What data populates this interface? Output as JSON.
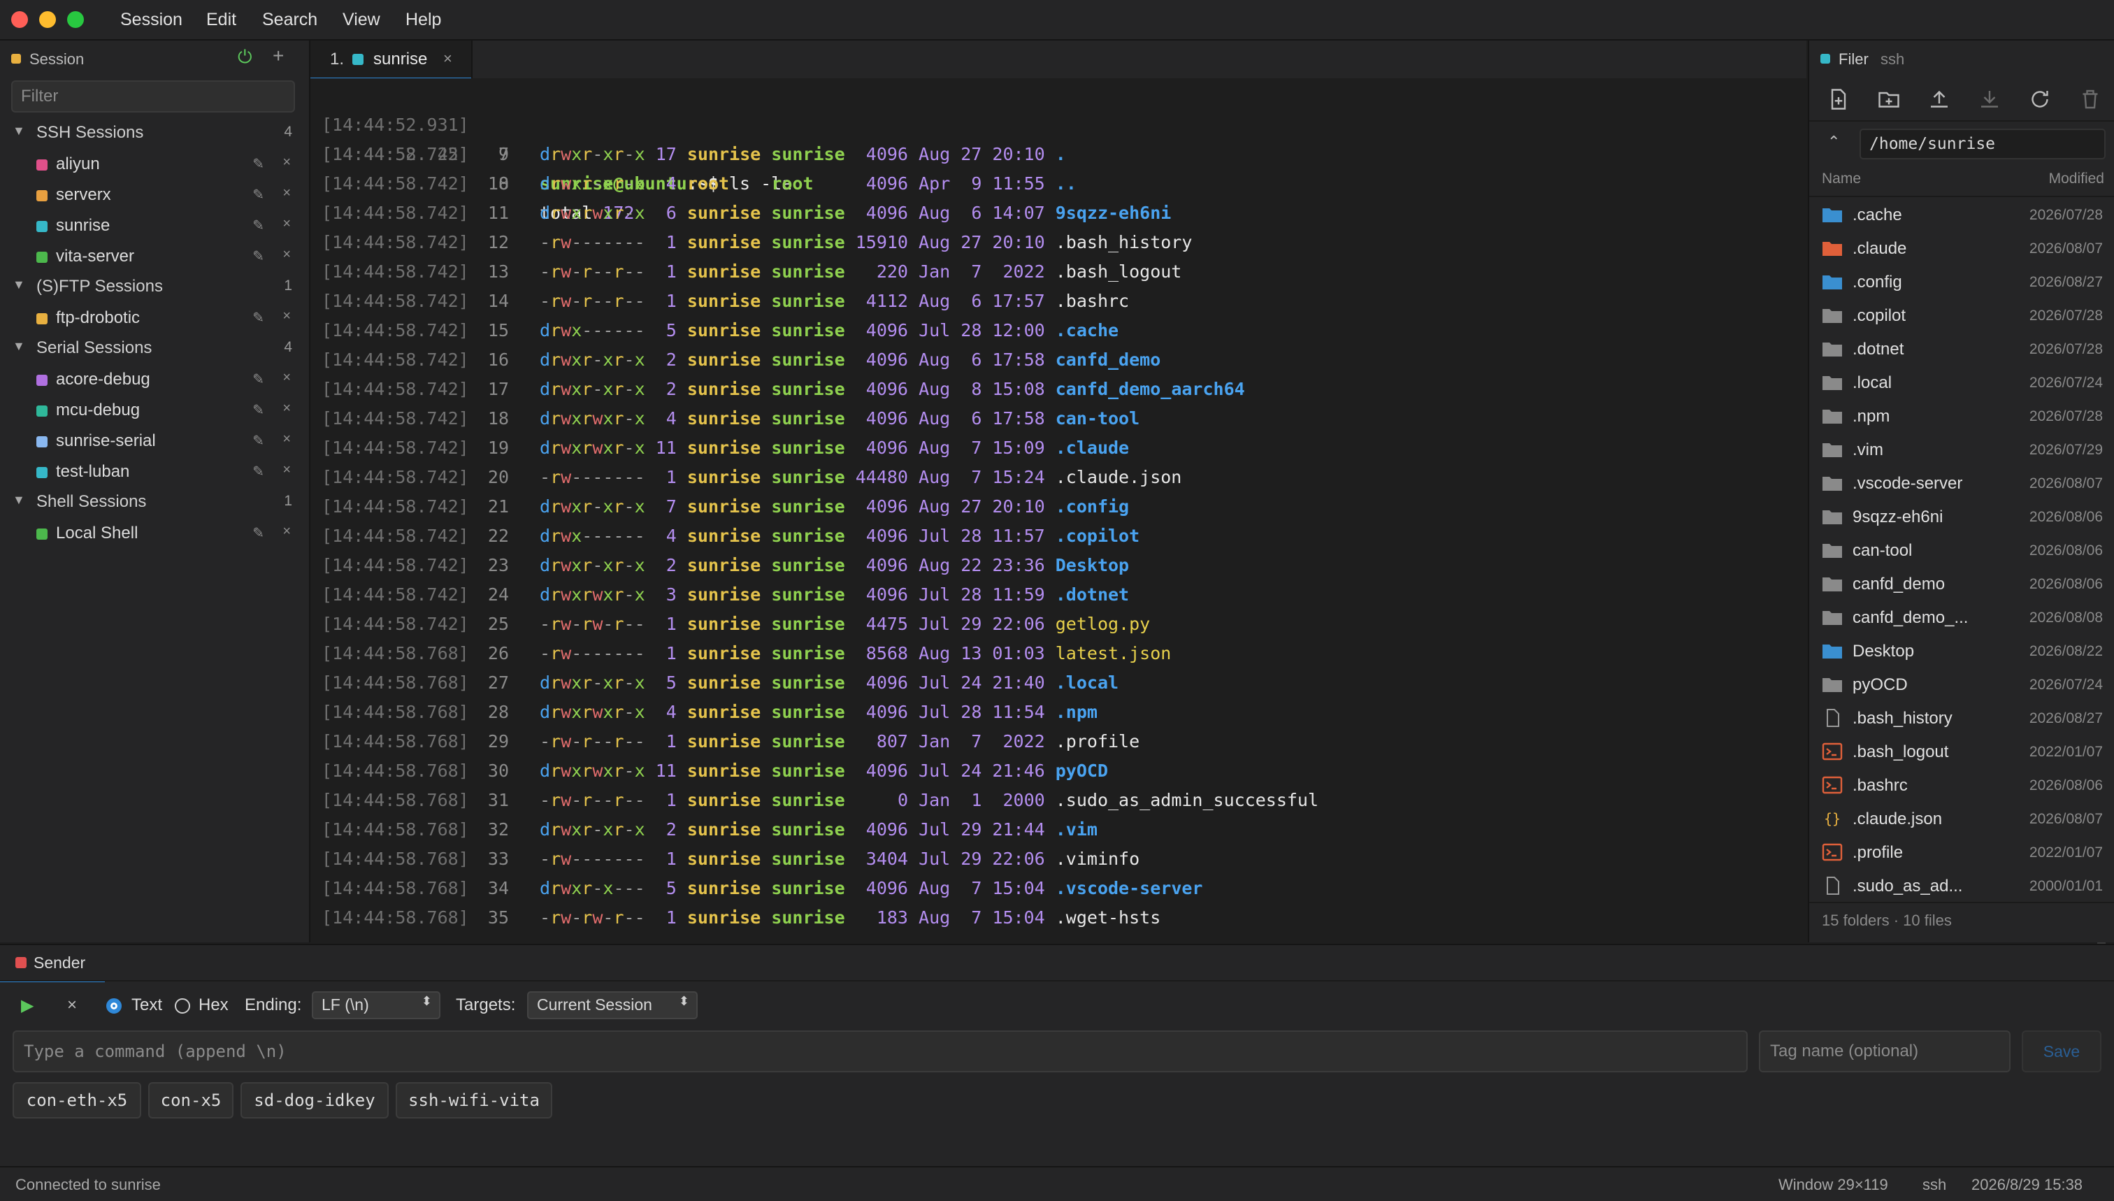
{
  "menu": [
    "Session",
    "Edit",
    "Search",
    "View",
    "Help"
  ],
  "left_panel": {
    "title": "Session",
    "filter_placeholder": "Filter",
    "groups": [
      {
        "name": "SSH Sessions",
        "count": "4",
        "items": [
          {
            "name": "aliyun",
            "color": "#e0508a"
          },
          {
            "name": "serverx",
            "color": "#e8a040"
          },
          {
            "name": "sunrise",
            "color": "#36b8c8"
          },
          {
            "name": "vita-server",
            "color": "#4cb84c"
          }
        ]
      },
      {
        "name": "(S)FTP Sessions",
        "count": "1",
        "items": [
          {
            "name": "ftp-drobotic",
            "color": "#e8b040"
          }
        ]
      },
      {
        "name": "Serial Sessions",
        "count": "4",
        "items": [
          {
            "name": "acore-debug",
            "color": "#b070e0"
          },
          {
            "name": "mcu-debug",
            "color": "#2fb89a"
          },
          {
            "name": "sunrise-serial",
            "color": "#8ab8f0"
          },
          {
            "name": "test-luban",
            "color": "#36b8c8"
          }
        ]
      },
      {
        "name": "Shell Sessions",
        "count": "1",
        "items": [
          {
            "name": "Local Shell",
            "color": "#4cb84c"
          }
        ]
      }
    ]
  },
  "tab": {
    "number": "1.",
    "label": "sunrise",
    "close": "×",
    "color": "#36b8c8"
  },
  "terminal": {
    "prompt_user": "sunrise@ubuntu",
    "prompt_path": ":~$",
    "command": " ls -la",
    "first_ts": "[14:44:52.931]",
    "first_ln": "7",
    "total_ts": "[14:44:52.725]",
    "total_ln": "8",
    "total_label": "total",
    "total_value": "172",
    "rows": [
      {
        "ts": "[14:44:58.742]",
        "ln": "9",
        "perm": "drwxr-xr-x",
        "links": "17",
        "owner": "sunrise",
        "group": "sunrise",
        "size": "4096",
        "date": "Aug 27 20:10",
        "name": ".",
        "kind": "dir"
      },
      {
        "ts": "[14:44:58.742]",
        "ln": "10",
        "perm": "drwxr-xr-x",
        "links": "4",
        "owner": "root",
        "group": "root",
        "size": "4096",
        "date": "Apr  9 11:55",
        "name": "..",
        "kind": "dir"
      },
      {
        "ts": "[14:44:58.742]",
        "ln": "11",
        "perm": "drwxrwxr-x",
        "links": "6",
        "owner": "sunrise",
        "group": "sunrise",
        "size": "4096",
        "date": "Aug  6 14:07",
        "name": "9sqzz-eh6ni",
        "kind": "dir"
      },
      {
        "ts": "[14:44:58.742]",
        "ln": "12",
        "perm": "-rw-------",
        "links": "1",
        "owner": "sunrise",
        "group": "sunrise",
        "size": "15910",
        "date": "Aug 27 20:10",
        "name": ".bash_history",
        "kind": "file"
      },
      {
        "ts": "[14:44:58.742]",
        "ln": "13",
        "perm": "-rw-r--r--",
        "links": "1",
        "owner": "sunrise",
        "group": "sunrise",
        "size": "220",
        "date": "Jan  7  2022",
        "name": ".bash_logout",
        "kind": "file"
      },
      {
        "ts": "[14:44:58.742]",
        "ln": "14",
        "perm": "-rw-r--r--",
        "links": "1",
        "owner": "sunrise",
        "group": "sunrise",
        "size": "4112",
        "date": "Aug  6 17:57",
        "name": ".bashrc",
        "kind": "file"
      },
      {
        "ts": "[14:44:58.742]",
        "ln": "15",
        "perm": "drwx------",
        "links": "5",
        "owner": "sunrise",
        "group": "sunrise",
        "size": "4096",
        "date": "Jul 28 12:00",
        "name": ".cache",
        "kind": "dir"
      },
      {
        "ts": "[14:44:58.742]",
        "ln": "16",
        "perm": "drwxr-xr-x",
        "links": "2",
        "owner": "sunrise",
        "group": "sunrise",
        "size": "4096",
        "date": "Aug  6 17:58",
        "name": "canfd_demo",
        "kind": "dir"
      },
      {
        "ts": "[14:44:58.742]",
        "ln": "17",
        "perm": "drwxr-xr-x",
        "links": "2",
        "owner": "sunrise",
        "group": "sunrise",
        "size": "4096",
        "date": "Aug  8 15:08",
        "name": "canfd_demo_aarch64",
        "kind": "dir"
      },
      {
        "ts": "[14:44:58.742]",
        "ln": "18",
        "perm": "drwxrwxr-x",
        "links": "4",
        "owner": "sunrise",
        "group": "sunrise",
        "size": "4096",
        "date": "Aug  6 17:58",
        "name": "can-tool",
        "kind": "dir"
      },
      {
        "ts": "[14:44:58.742]",
        "ln": "19",
        "perm": "drwxrwxr-x",
        "links": "11",
        "owner": "sunrise",
        "group": "sunrise",
        "size": "4096",
        "date": "Aug  7 15:09",
        "name": ".claude",
        "kind": "dir"
      },
      {
        "ts": "[14:44:58.742]",
        "ln": "20",
        "perm": "-rw-------",
        "links": "1",
        "owner": "sunrise",
        "group": "sunrise",
        "size": "44480",
        "date": "Aug  7 15:24",
        "name": ".claude.json",
        "kind": "file"
      },
      {
        "ts": "[14:44:58.742]",
        "ln": "21",
        "perm": "drwxr-xr-x",
        "links": "7",
        "owner": "sunrise",
        "group": "sunrise",
        "size": "4096",
        "date": "Aug 27 20:10",
        "name": ".config",
        "kind": "dir"
      },
      {
        "ts": "[14:44:58.742]",
        "ln": "22",
        "perm": "drwx------",
        "links": "4",
        "owner": "sunrise",
        "group": "sunrise",
        "size": "4096",
        "date": "Jul 28 11:57",
        "name": ".copilot",
        "kind": "dir"
      },
      {
        "ts": "[14:44:58.742]",
        "ln": "23",
        "perm": "drwxr-xr-x",
        "links": "2",
        "owner": "sunrise",
        "group": "sunrise",
        "size": "4096",
        "date": "Aug 22 23:36",
        "name": "Desktop",
        "kind": "dir"
      },
      {
        "ts": "[14:44:58.742]",
        "ln": "24",
        "perm": "drwxrwxr-x",
        "links": "3",
        "owner": "sunrise",
        "group": "sunrise",
        "size": "4096",
        "date": "Jul 28 11:59",
        "name": ".dotnet",
        "kind": "dir"
      },
      {
        "ts": "[14:44:58.742]",
        "ln": "25",
        "perm": "-rw-rw-r--",
        "links": "1",
        "owner": "sunrise",
        "group": "sunrise",
        "size": "4475",
        "date": "Jul 29 22:06",
        "name": "getlog.py",
        "kind": "yfile"
      },
      {
        "ts": "[14:44:58.768]",
        "ln": "26",
        "perm": "-rw-------",
        "links": "1",
        "owner": "sunrise",
        "group": "sunrise",
        "size": "8568",
        "date": "Aug 13 01:03",
        "name": "latest.json",
        "kind": "yfile"
      },
      {
        "ts": "[14:44:58.768]",
        "ln": "27",
        "perm": "drwxr-xr-x",
        "links": "5",
        "owner": "sunrise",
        "group": "sunrise",
        "size": "4096",
        "date": "Jul 24 21:40",
        "name": ".local",
        "kind": "dir"
      },
      {
        "ts": "[14:44:58.768]",
        "ln": "28",
        "perm": "drwxrwxr-x",
        "links": "4",
        "owner": "sunrise",
        "group": "sunrise",
        "size": "4096",
        "date": "Jul 28 11:54",
        "name": ".npm",
        "kind": "dir"
      },
      {
        "ts": "[14:44:58.768]",
        "ln": "29",
        "perm": "-rw-r--r--",
        "links": "1",
        "owner": "sunrise",
        "group": "sunrise",
        "size": "807",
        "date": "Jan  7  2022",
        "name": ".profile",
        "kind": "file"
      },
      {
        "ts": "[14:44:58.768]",
        "ln": "30",
        "perm": "drwxrwxr-x",
        "links": "11",
        "owner": "sunrise",
        "group": "sunrise",
        "size": "4096",
        "date": "Jul 24 21:46",
        "name": "pyOCD",
        "kind": "dir"
      },
      {
        "ts": "[14:44:58.768]",
        "ln": "31",
        "perm": "-rw-r--r--",
        "links": "1",
        "owner": "sunrise",
        "group": "sunrise",
        "size": "0",
        "date": "Jan  1  2000",
        "name": ".sudo_as_admin_successful",
        "kind": "file"
      },
      {
        "ts": "[14:44:58.768]",
        "ln": "32",
        "perm": "drwxr-xr-x",
        "links": "2",
        "owner": "sunrise",
        "group": "sunrise",
        "size": "4096",
        "date": "Jul 29 21:44",
        "name": ".vim",
        "kind": "dir"
      },
      {
        "ts": "[14:44:58.768]",
        "ln": "33",
        "perm": "-rw-------",
        "links": "1",
        "owner": "sunrise",
        "group": "sunrise",
        "size": "3404",
        "date": "Jul 29 22:06",
        "name": ".viminfo",
        "kind": "file"
      },
      {
        "ts": "[14:44:58.768]",
        "ln": "34",
        "perm": "drwxr-x---",
        "links": "5",
        "owner": "sunrise",
        "group": "sunrise",
        "size": "4096",
        "date": "Aug  7 15:04",
        "name": ".vscode-server",
        "kind": "dir"
      },
      {
        "ts": "[14:44:58.768]",
        "ln": "35",
        "perm": "-rw-rw-r--",
        "links": "1",
        "owner": "sunrise",
        "group": "sunrise",
        "size": "183",
        "date": "Aug  7 15:04",
        "name": ".wget-hsts",
        "kind": "file"
      }
    ]
  },
  "filer": {
    "title": "Filer",
    "subtitle": "ssh",
    "path": "/home/sunrise",
    "col_name": "Name",
    "col_modified": "Modified",
    "files": [
      {
        "name": ".cache",
        "date": "2026/07/28",
        "icon": "folder-cache-icon",
        "color": "#3a8fd0"
      },
      {
        "name": ".claude",
        "date": "2026/08/07",
        "icon": "folder-claude-icon",
        "color": "#e0603a"
      },
      {
        "name": ".config",
        "date": "2026/08/27",
        "icon": "folder-config-icon",
        "color": "#3a8fd0"
      },
      {
        "name": ".copilot",
        "date": "2026/07/28",
        "icon": "folder-icon",
        "color": "#8a8a8a"
      },
      {
        "name": ".dotnet",
        "date": "2026/07/28",
        "icon": "folder-icon",
        "color": "#8a8a8a"
      },
      {
        "name": ".local",
        "date": "2026/07/24",
        "icon": "folder-icon",
        "color": "#8a8a8a"
      },
      {
        "name": ".npm",
        "date": "2026/07/28",
        "icon": "folder-icon",
        "color": "#8a8a8a"
      },
      {
        "name": ".vim",
        "date": "2026/07/29",
        "icon": "folder-icon",
        "color": "#8a8a8a"
      },
      {
        "name": ".vscode-server",
        "date": "2026/08/07",
        "icon": "folder-icon",
        "color": "#8a8a8a"
      },
      {
        "name": "9sqzz-eh6ni",
        "date": "2026/08/06",
        "icon": "folder-icon",
        "color": "#8a8a8a"
      },
      {
        "name": "can-tool",
        "date": "2026/08/06",
        "icon": "folder-icon",
        "color": "#8a8a8a"
      },
      {
        "name": "canfd_demo",
        "date": "2026/08/06",
        "icon": "folder-icon",
        "color": "#8a8a8a"
      },
      {
        "name": "canfd_demo_...",
        "date": "2026/08/08",
        "icon": "folder-icon",
        "color": "#8a8a8a"
      },
      {
        "name": "Desktop",
        "date": "2026/08/22",
        "icon": "folder-desktop-icon",
        "color": "#3a8fd0"
      },
      {
        "name": "pyOCD",
        "date": "2026/07/24",
        "icon": "folder-icon",
        "color": "#8a8a8a"
      },
      {
        "name": ".bash_history",
        "date": "2026/08/27",
        "icon": "file-icon",
        "color": "#9a9a9a"
      },
      {
        "name": ".bash_logout",
        "date": "2022/01/07",
        "icon": "terminal-file-icon",
        "color": "#e0603a"
      },
      {
        "name": ".bashrc",
        "date": "2026/08/06",
        "icon": "terminal-file-icon",
        "color": "#e0603a"
      },
      {
        "name": ".claude.json",
        "date": "2026/08/07",
        "icon": "json-file-icon",
        "color": "#e8b040"
      },
      {
        "name": ".profile",
        "date": "2022/01/07",
        "icon": "terminal-file-icon",
        "color": "#e0603a"
      },
      {
        "name": ".sudo_as_ad...",
        "date": "2000/01/01",
        "icon": "file-icon",
        "color": "#9a9a9a"
      }
    ],
    "summary": "15 folders · 10 files"
  },
  "sender": {
    "tab_label": "Sender",
    "mode_text": "Text",
    "mode_hex": "Hex",
    "ending_label": "Ending:",
    "ending_value": "LF (\\n)",
    "targets_label": "Targets:",
    "targets_value": "Current Session",
    "command_placeholder": "Type a command (append \\n)",
    "tag_placeholder": "Tag name (optional)",
    "save_label": "Save",
    "chips": [
      "con-eth-x5",
      "con-x5",
      "sd-dog-idkey",
      "ssh-wifi-vita"
    ]
  },
  "status": {
    "left": "Connected to sunrise",
    "window": "Window 29×119",
    "protocol": "ssh",
    "datetime": "2026/8/29 15:38"
  },
  "colors": {
    "accent": "#2f88d8",
    "power": "#5cc85c",
    "dir_blue": "#4aa3f0",
    "prompt_green": "#8fd14f"
  }
}
